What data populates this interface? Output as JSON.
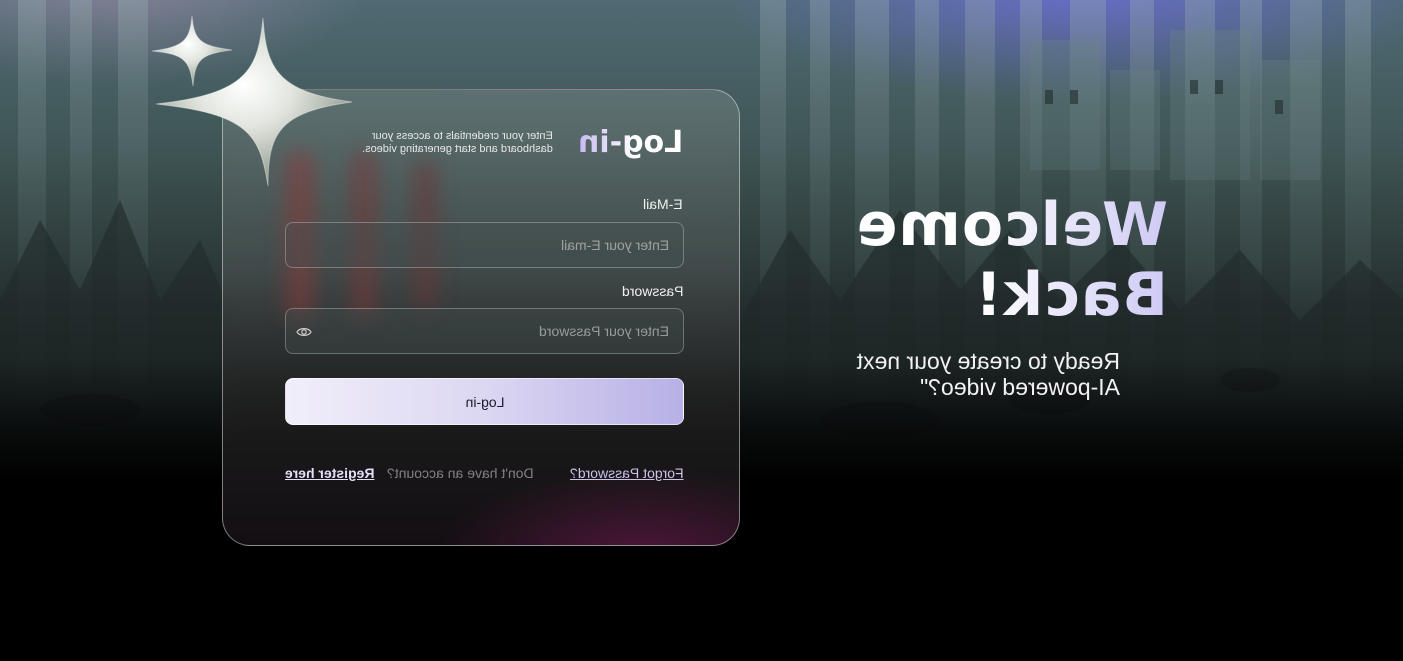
{
  "welcome": {
    "title_line1": "Welcome",
    "title_line2": "Back!",
    "subtitle_line1": "Ready to create your next",
    "subtitle_line2": "AI-powered video?\""
  },
  "login_card": {
    "title": "Log-in",
    "description_line1": "Enter your credentials to access your",
    "description_line2": "dashboard and start generating videos.",
    "email": {
      "label": "E-Mail",
      "placeholder": "Enter your E-mail",
      "value": ""
    },
    "password": {
      "label": "Password",
      "placeholder": "Enter your Password",
      "value": "",
      "toggle_icon": "eye-icon"
    },
    "submit_label": "Log-in",
    "forgot_password": "Forgot Password?",
    "no_account_text": "Don't have an account?",
    "register_link": "Register here"
  },
  "decor": {
    "sparkle_icon": "four-point-star-icon"
  },
  "colors": {
    "accent_lavender": "#b7b0e6",
    "button_start": "#f1eefa",
    "card_glow": "#821e5a",
    "sky_glow": "#6e6ee6",
    "page_background": "#000000"
  },
  "text_orientation": "mirrored"
}
